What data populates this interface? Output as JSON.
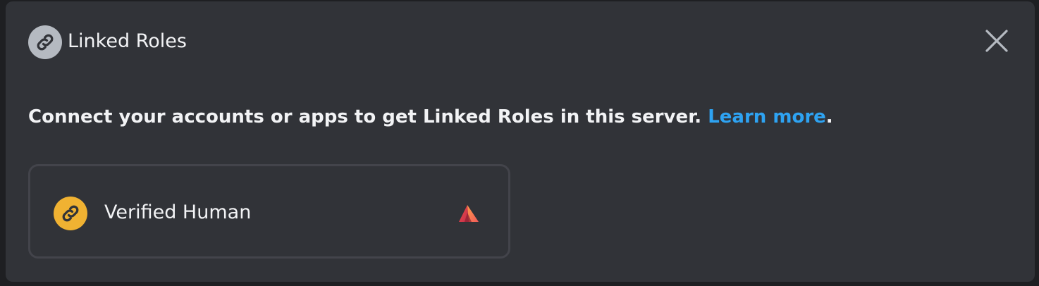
{
  "header": {
    "title": "Linked Roles",
    "icon": "link-icon",
    "close_icon": "close-icon"
  },
  "description": {
    "text": "Connect your accounts or apps to get Linked Roles in this server. ",
    "link_text": "Learn more",
    "suffix": "."
  },
  "roles": [
    {
      "label": "Verified Human",
      "icon": "link-icon",
      "icon_color": "#f0b232",
      "app_icon": "app-logo-icon"
    }
  ],
  "colors": {
    "background": "#313338",
    "text": "#f2f3f5",
    "link": "#2ea3f2",
    "accent_role": "#f0b232"
  }
}
